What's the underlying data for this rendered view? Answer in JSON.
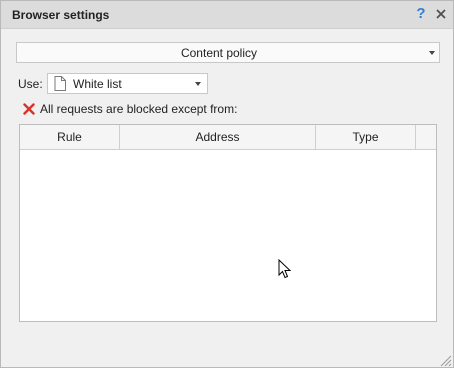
{
  "window": {
    "title": "Browser settings",
    "help_glyph": "?"
  },
  "policy": {
    "selected": "Content policy"
  },
  "use": {
    "label": "Use:",
    "value": "White list",
    "icon": "document-icon"
  },
  "notice": {
    "icon": "red-x-icon",
    "text": "All requests are blocked except from:"
  },
  "table": {
    "columns": [
      "Rule",
      "Address",
      "Type"
    ],
    "rows": []
  },
  "colors": {
    "titlebar": "#dcdcdc",
    "background": "#f0f0f0",
    "help": "#2f80d0",
    "error_red": "#d9322b"
  }
}
